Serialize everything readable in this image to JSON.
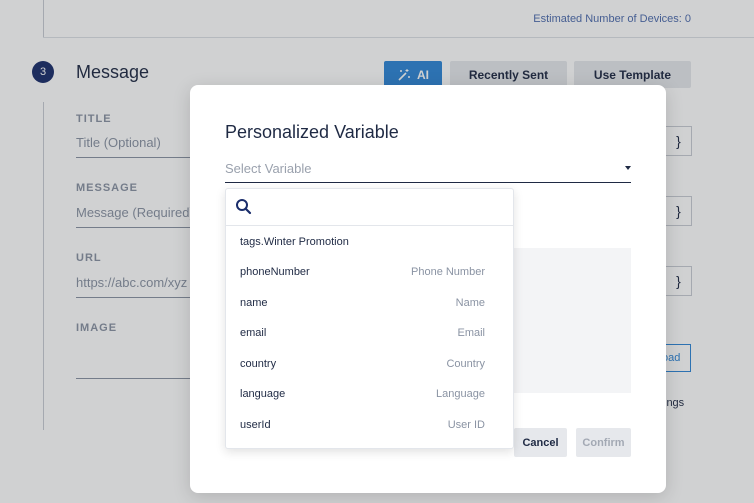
{
  "background": {
    "estimated_devices": "Estimated Number of Devices: 0",
    "step_number": "3",
    "step_title": "Message",
    "ai_button": "AI",
    "recently_sent_button": "Recently Sent",
    "use_template_button": "Use Template",
    "fields": {
      "title_label": "TITLE",
      "title_placeholder": "Title (Optional)",
      "message_label": "MESSAGE",
      "message_placeholder": "Message (Required)",
      "url_label": "URL",
      "url_placeholder": "https://abc.com/xyz",
      "image_label": "IMAGE"
    },
    "brace_text": "}",
    "upload_text": "oad",
    "settings_text": "ings"
  },
  "modal": {
    "title": "Personalized Variable",
    "select_placeholder": "Select Variable",
    "cancel_button": "Cancel",
    "confirm_button": "Confirm"
  },
  "dropdown": {
    "search_value": "",
    "items": [
      {
        "name": "tags.Winter Promotion",
        "label": ""
      },
      {
        "name": "phoneNumber",
        "label": "Phone Number"
      },
      {
        "name": "name",
        "label": "Name"
      },
      {
        "name": "email",
        "label": "Email"
      },
      {
        "name": "country",
        "label": "Country"
      },
      {
        "name": "language",
        "label": "Language"
      },
      {
        "name": "userId",
        "label": "User ID"
      }
    ]
  },
  "colors": {
    "accent": "#2f86d6",
    "step_badge": "#1a2d6b",
    "text": "#1f2a44"
  }
}
